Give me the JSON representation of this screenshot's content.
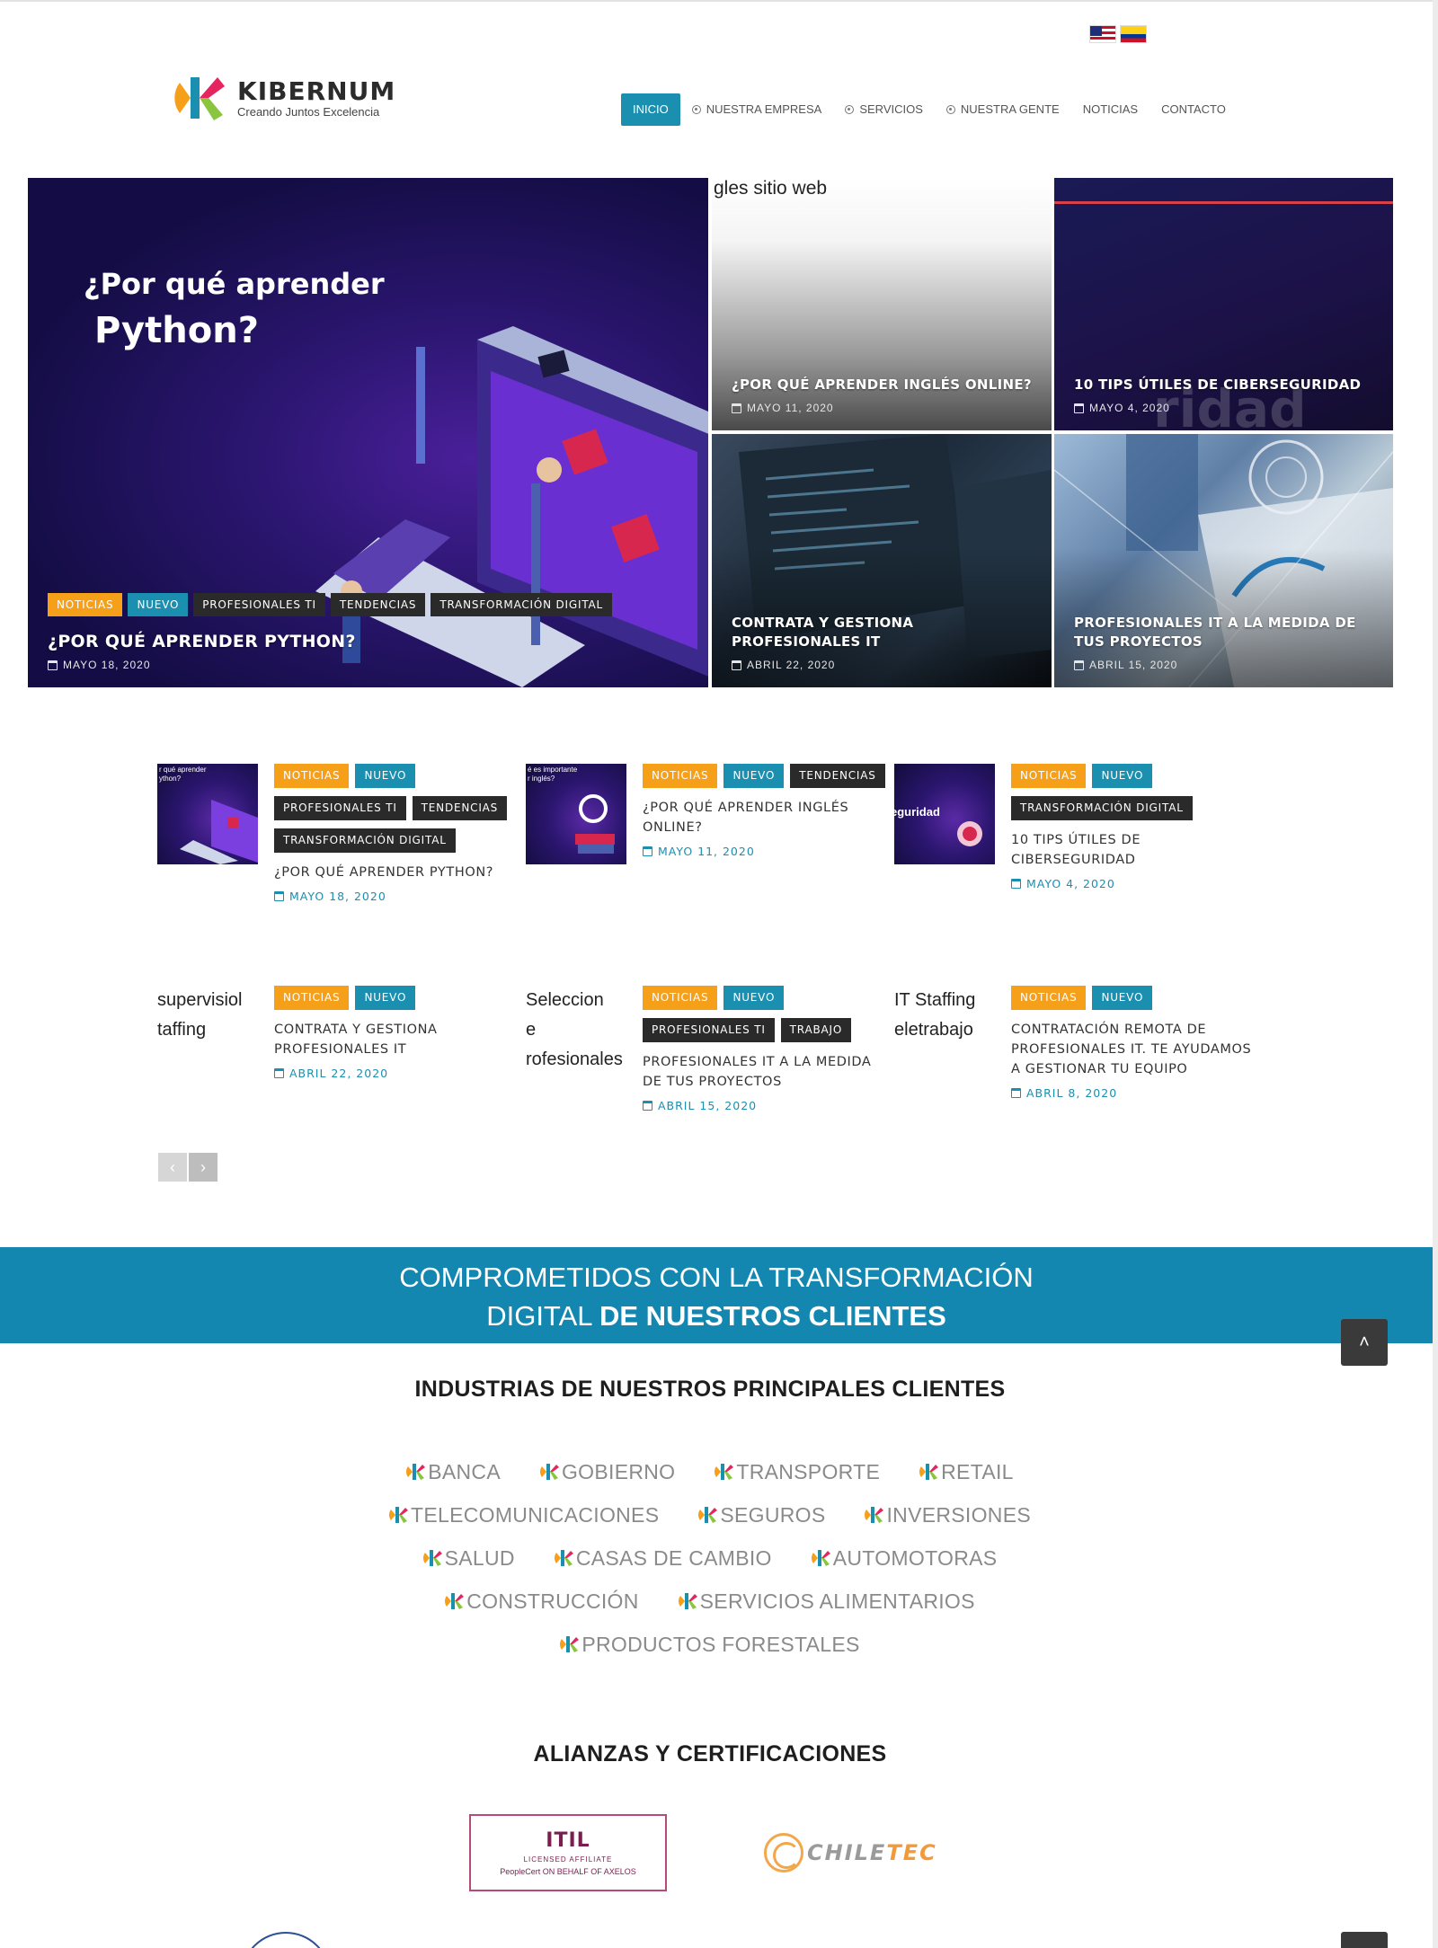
{
  "colors": {
    "accent": "#1a8fb0",
    "orange": "#f6a01a",
    "dark_tag": "#2a2a2a",
    "banner": "#1487b0"
  },
  "flags": [
    {
      "name": "us-flag-icon"
    },
    {
      "name": "colombia-flag-icon"
    }
  ],
  "logo": {
    "name": "KIBERNUM",
    "tagline": "Creando Juntos Excelencia"
  },
  "nav": {
    "items": [
      {
        "label": "INICIO",
        "active": true
      },
      {
        "label": "NUESTRA EMPRESA",
        "icon": "target-icon"
      },
      {
        "label": "SERVICIOS",
        "icon": "target-icon"
      },
      {
        "label": "NUESTRA GENTE",
        "icon": "target-icon"
      },
      {
        "label": "NOTICIAS"
      },
      {
        "label": "CONTACTO"
      }
    ]
  },
  "hero": {
    "main": {
      "headline_line1": "¿Por qué aprender",
      "headline_line2": "Python?",
      "tags": [
        "NOTICIAS",
        "NUEVO",
        "PROFESIONALES TI",
        "TENDENCIAS",
        "TRANSFORMACIÓN DIGITAL"
      ],
      "title": "¿POR QUÉ APRENDER PYTHON?",
      "date": "MAYO 18, 2020"
    },
    "tiles": [
      {
        "alt": "gles sitio web",
        "title": "¿POR QUÉ APRENDER INGLÉS ONLINE?",
        "date": "MAYO 11, 2020"
      },
      {
        "ghost": "ridad",
        "title": "10 TIPS ÚTILES DE CIBERSEGURIDAD",
        "date": "MAYO 4, 2020"
      },
      {
        "title": "CONTRATA Y GESTIONA PROFESIONALES IT",
        "date": "ABRIL 22, 2020"
      },
      {
        "title": "PROFESIONALES IT A LA MEDIDA DE TUS PROYECTOS",
        "date": "ABRIL 15, 2020"
      }
    ]
  },
  "posts": [
    {
      "thumb_text": "r qué aprender\nython?",
      "tags": [
        [
          "NOTICIAS",
          "orange"
        ],
        [
          "NUEVO",
          "blue"
        ],
        [
          "PROFESIONALES TI",
          "dark"
        ],
        [
          "TENDENCIAS",
          "dark"
        ],
        [
          "TRANSFORMACIÓN DIGITAL",
          "dark"
        ]
      ],
      "title": "¿POR QUÉ APRENDER PYTHON?",
      "date": "MAYO 18, 2020"
    },
    {
      "thumb_text": "é es importante\nr inglés?",
      "tags": [
        [
          "NOTICIAS",
          "orange"
        ],
        [
          "NUEVO",
          "blue"
        ],
        [
          "TENDENCIAS",
          "dark"
        ]
      ],
      "title": "¿POR QUÉ APRENDER INGLÉS ONLINE?",
      "date": "MAYO 11, 2020"
    },
    {
      "thumb_big": "eguridad",
      "tags": [
        [
          "NOTICIAS",
          "orange"
        ],
        [
          "NUEVO",
          "blue"
        ],
        [
          "TRANSFORMACIÓN DIGITAL",
          "dark"
        ]
      ],
      "title": "10 TIPS ÚTILES DE CIBERSEGURIDAD",
      "date": "MAYO 4, 2020"
    },
    {
      "alt": "supervisiol\ntaffing",
      "tags": [
        [
          "NOTICIAS",
          "orange"
        ],
        [
          "NUEVO",
          "blue"
        ]
      ],
      "title": "CONTRATA Y GESTIONA PROFESIONALES IT",
      "date": "ABRIL 22, 2020"
    },
    {
      "alt": "Seleccion\ne\nrofesionales",
      "tags": [
        [
          "NOTICIAS",
          "orange"
        ],
        [
          "NUEVO",
          "blue"
        ],
        [
          "PROFESIONALES TI",
          "dark"
        ],
        [
          "TRABAJO",
          "dark"
        ]
      ],
      "title": "PROFESIONALES IT A LA MEDIDA DE TUS PROYECTOS",
      "date": "ABRIL 15, 2020"
    },
    {
      "alt": "IT Staffing\neletrabajo",
      "tags": [
        [
          "NOTICIAS",
          "orange"
        ],
        [
          "NUEVO",
          "blue"
        ]
      ],
      "title": "CONTRATACIÓN REMOTA DE PROFESIONALES IT. TE AYUDAMOS A GESTIONAR TU EQUIPO",
      "date": "ABRIL 8, 2020"
    }
  ],
  "pager": {
    "prev": "‹",
    "next": "›"
  },
  "banner": {
    "line1": "COMPROMETIDOS CON LA TRANSFORMACIÓN",
    "line2_regular": "DIGITAL ",
    "line2_bold": "DE NUESTROS CLIENTES"
  },
  "scroll_top": {
    "label": "˄"
  },
  "industries": {
    "title": "INDUSTRIAS DE NUESTROS PRINCIPALES CLIENTES",
    "rows": [
      [
        "BANCA",
        "GOBIERNO",
        "TRANSPORTE",
        "RETAIL"
      ],
      [
        "TELECOMUNICACIONES",
        "SEGUROS",
        "INVERSIONES"
      ],
      [
        "SALUD",
        "CASAS DE CAMBIO",
        "AUTOMOTORAS"
      ],
      [
        "CONSTRUCCIÓN",
        "SERVICIOS ALIMENTARIOS"
      ],
      [
        "PRODUCTOS FORESTALES"
      ]
    ]
  },
  "alliances": {
    "title": "ALIANZAS Y CERTIFICACIONES",
    "itil": {
      "name": "ITIL",
      "sub": "LICENSED AFFILIATE",
      "foot": "PeopleCert ON BEHALF OF AXELOS"
    },
    "chiletec": {
      "part1": "CHILE",
      "part2": "TEC"
    }
  }
}
